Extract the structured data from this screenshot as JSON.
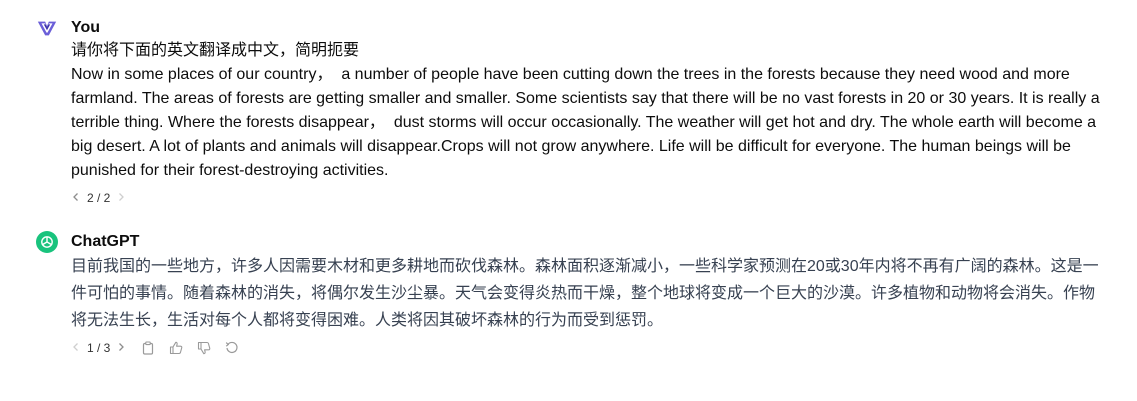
{
  "user_message": {
    "author": "You",
    "prompt": "请你将下面的英文翻译成中文，简明扼要",
    "body": "Now in some places of our country，  a number of people have been cutting down the trees in the forests because they need wood and more farmland. The areas of forests are getting smaller and smaller. Some scientists say that there will be no vast forests in 20 or 30 years. It is really a terrible thing. Where the forests disappear，  dust storms will occur occasionally. The weather will get hot and dry. The whole earth will become a big desert. A lot of plants and animals will disappear.Crops will not grow anywhere. Life will be difficult for everyone. The human beings will be punished for their forest-destroying activities.",
    "version": "2 / 2"
  },
  "assistant_message": {
    "author": "ChatGPT",
    "body": "目前我国的一些地方，许多人因需要木材和更多耕地而砍伐森林。森林面积逐渐减小，一些科学家预测在20或30年内将不再有广阔的森林。这是一件可怕的事情。随着森林的消失，将偶尔发生沙尘暴。天气会变得炎热而干燥，整个地球将变成一个巨大的沙漠。许多植物和动物将会消失。作物将无法生长，生活对每个人都将变得困难。人类将因其破坏森林的行为而受到惩罚。",
    "version": "1 / 3"
  },
  "icons": {
    "prev": "chevron-left-icon",
    "next": "chevron-right-icon",
    "copy": "clipboard-icon",
    "like": "thumbs-up-icon",
    "dislike": "thumbs-down-icon",
    "regenerate": "regenerate-icon"
  },
  "colors": {
    "user_avatar_primary": "#5b4fcf",
    "chatgpt_avatar_bg": "#19c37d",
    "body_text": "#0d0d0d",
    "muted": "#9a9a9a"
  }
}
